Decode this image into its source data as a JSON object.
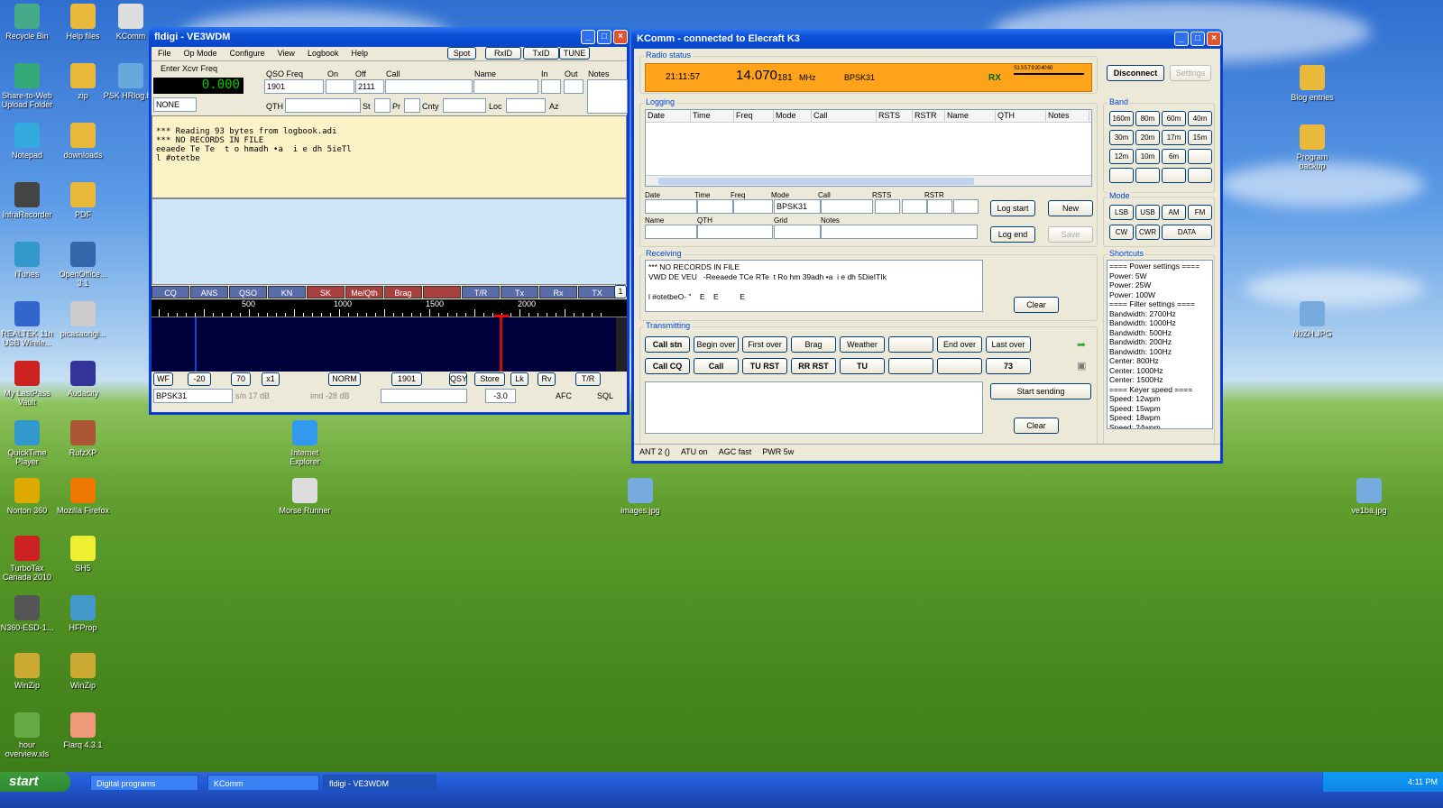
{
  "desktop": {
    "icons": [
      {
        "label": "Recycle Bin"
      },
      {
        "label": "Help files"
      },
      {
        "label": "KComm"
      },
      {
        "label": "Share-to-Web Upload Folder"
      },
      {
        "label": "zip"
      },
      {
        "label": "PSK HRlog.bm"
      },
      {
        "label": "Notepad"
      },
      {
        "label": "downloads"
      },
      {
        "label": "InfraRecorder"
      },
      {
        "label": "PDF"
      },
      {
        "label": "iTunes"
      },
      {
        "label": "OpenOffice... 3.1"
      },
      {
        "label": "REALTEK 11n USB Wirele..."
      },
      {
        "label": "picasaorigi..."
      },
      {
        "label": "My LastPass Vault"
      },
      {
        "label": "Audacity"
      },
      {
        "label": "QuickTime Player"
      },
      {
        "label": "RufzXP"
      },
      {
        "label": "Norton 360"
      },
      {
        "label": "Mozilla Firefox"
      },
      {
        "label": "TurboTax Canada 2010"
      },
      {
        "label": "SH5"
      },
      {
        "label": "N360-ESD-1..."
      },
      {
        "label": "HFProp"
      },
      {
        "label": "WinZip"
      },
      {
        "label": "WinZip"
      },
      {
        "label": "hour overview.xls"
      },
      {
        "label": "Flarq 4.3.1"
      },
      {
        "label": "Internet Explorer"
      },
      {
        "label": "Morse Runner"
      },
      {
        "label": "images.jpg"
      },
      {
        "label": "Blog entries"
      },
      {
        "label": "Program backup"
      },
      {
        "label": "N0ZH.JPG"
      },
      {
        "label": "ve1ba.jpg"
      }
    ]
  },
  "fldigi": {
    "title": "fldigi - VE3WDM",
    "menu": [
      "File",
      "Op Mode",
      "Configure",
      "View",
      "Logbook",
      "Help"
    ],
    "toolbar": [
      "Spot",
      "RxID",
      "TxID",
      "TUNE"
    ],
    "enter_freq": "Enter Xcvr Freq",
    "freq_display": "0.000",
    "mode_sel": "NONE",
    "hdr": {
      "qso_freq": "QSO Freq",
      "on": "On",
      "off": "Off",
      "call": "Call",
      "name": "Name",
      "in": "In",
      "out": "Out",
      "notes": "Notes"
    },
    "qso_freq_val": "1901",
    "off_val": "2111",
    "row2": {
      "qth": "QTH",
      "st": "St",
      "pr": "Pr",
      "cnty": "Cnty",
      "loc": "Loc",
      "az": "Az"
    },
    "rx_text": "*** Reading 93 bytes from logbook.adi\n*** NO RECORDS IN FILE\neeaede Te Te  t o hmadh •a  i e dh 5ieTl\nl #otetbe",
    "macros": [
      "CQ",
      "ANS",
      "QSO",
      "KN",
      "SK",
      "Me/Qth",
      "Brag",
      "",
      "T/R",
      "Tx",
      "Rx",
      "TX"
    ],
    "macro_page": "1",
    "scale": [
      "500",
      "1000",
      "1500",
      "2000"
    ],
    "bottom": [
      "WF",
      "-20",
      "70",
      "x1",
      "NORM",
      "1901",
      "QSY",
      "Store",
      "Lk",
      "Rv",
      "T/R"
    ],
    "status": {
      "mode": "BPSK31",
      "sn": "s/n 17 dB",
      "imd": "imd -28 dB",
      "offset": "-3.0",
      "afc": "AFC",
      "sql": "SQL"
    }
  },
  "kcomm": {
    "title": "KComm - connected to Elecraft K3",
    "radio_status": "Radio status",
    "time": "21:11:57",
    "freq": "14.070",
    "freq_sub": "181",
    "unit": "MHz",
    "mode": "BPSK31",
    "rx": "RX",
    "meter": "S1 3 5 7 9 20 40 60",
    "disconnect": "Disconnect",
    "settings": "Settings",
    "logging": "Logging",
    "log_cols": [
      "Date",
      "Time",
      "Freq",
      "Mode",
      "Call",
      "RSTS",
      "RSTR",
      "Name",
      "QTH",
      "Notes"
    ],
    "form": {
      "date": "Date",
      "time": "Time",
      "freq": "Freq",
      "mode": "Mode",
      "call": "Call",
      "rsts": "RSTS",
      "rstr": "RSTR",
      "name": "Name",
      "qth": "QTH",
      "grid": "Grid",
      "notes": "Notes",
      "mode_val": "BPSK31"
    },
    "log_start": "Log start",
    "new": "New",
    "log_end": "Log end",
    "save": "Save",
    "band": "Band",
    "bands": [
      "160m",
      "80m",
      "60m",
      "40m",
      "30m",
      "20m",
      "17m",
      "15m",
      "12m",
      "10m",
      "6m",
      "",
      "",
      "",
      "",
      ""
    ],
    "mode_label": "Mode",
    "modes": [
      "LSB",
      "USB",
      "AM",
      "FM",
      "CW",
      "CWR",
      "DATA"
    ],
    "receiving": "Receiving",
    "rx_text": "*** NO RECORDS IN FILE\nVWD DE VEU   -Reeaede TCe RTe  t Ro hm 39adh •a  i e dh 5DieITIk\n\nl #otetbeO- \"    E    E          E",
    "clear": "Clear",
    "shortcuts": "Shortcuts",
    "shortcut_items": [
      "==== Power settings ====",
      "Power: 5W",
      "Power: 25W",
      "Power: 100W",
      "==== Filter settings ====",
      "Bandwidth: 2700Hz",
      "Bandwidth: 1000Hz",
      "Bandwidth: 500Hz",
      "Bandwidth: 200Hz",
      "Bandwidth: 100Hz",
      "Center: 800Hz",
      "Center: 1000Hz",
      "Center: 1500Hz",
      "==== Keyer speed ====",
      "Speed: 12wpm",
      "Speed: 15wpm",
      "Speed: 18wpm",
      "Speed: 24wpm"
    ],
    "transmitting": "Transmitting",
    "tx1": [
      "Call stn",
      "Begin over",
      "First over",
      "Brag",
      "Weather",
      "",
      "End over",
      "Last over"
    ],
    "tx2": [
      "Call CQ",
      "Call",
      "TU RST",
      "RR RST",
      "TU",
      "",
      "",
      "73"
    ],
    "start_sending": "Start sending",
    "clear2": "Clear",
    "status": [
      "ANT 2 ()",
      "ATU on",
      "AGC fast",
      "PWR 5w"
    ]
  },
  "taskbar": {
    "start": "start",
    "tasks": [
      "Digital programs",
      "KComm",
      "fldigi - VE3WDM"
    ],
    "clock": "4:11 PM"
  },
  "colors": {
    "orange": "#ffa31a",
    "xp_blue": "#0a4fd6"
  }
}
